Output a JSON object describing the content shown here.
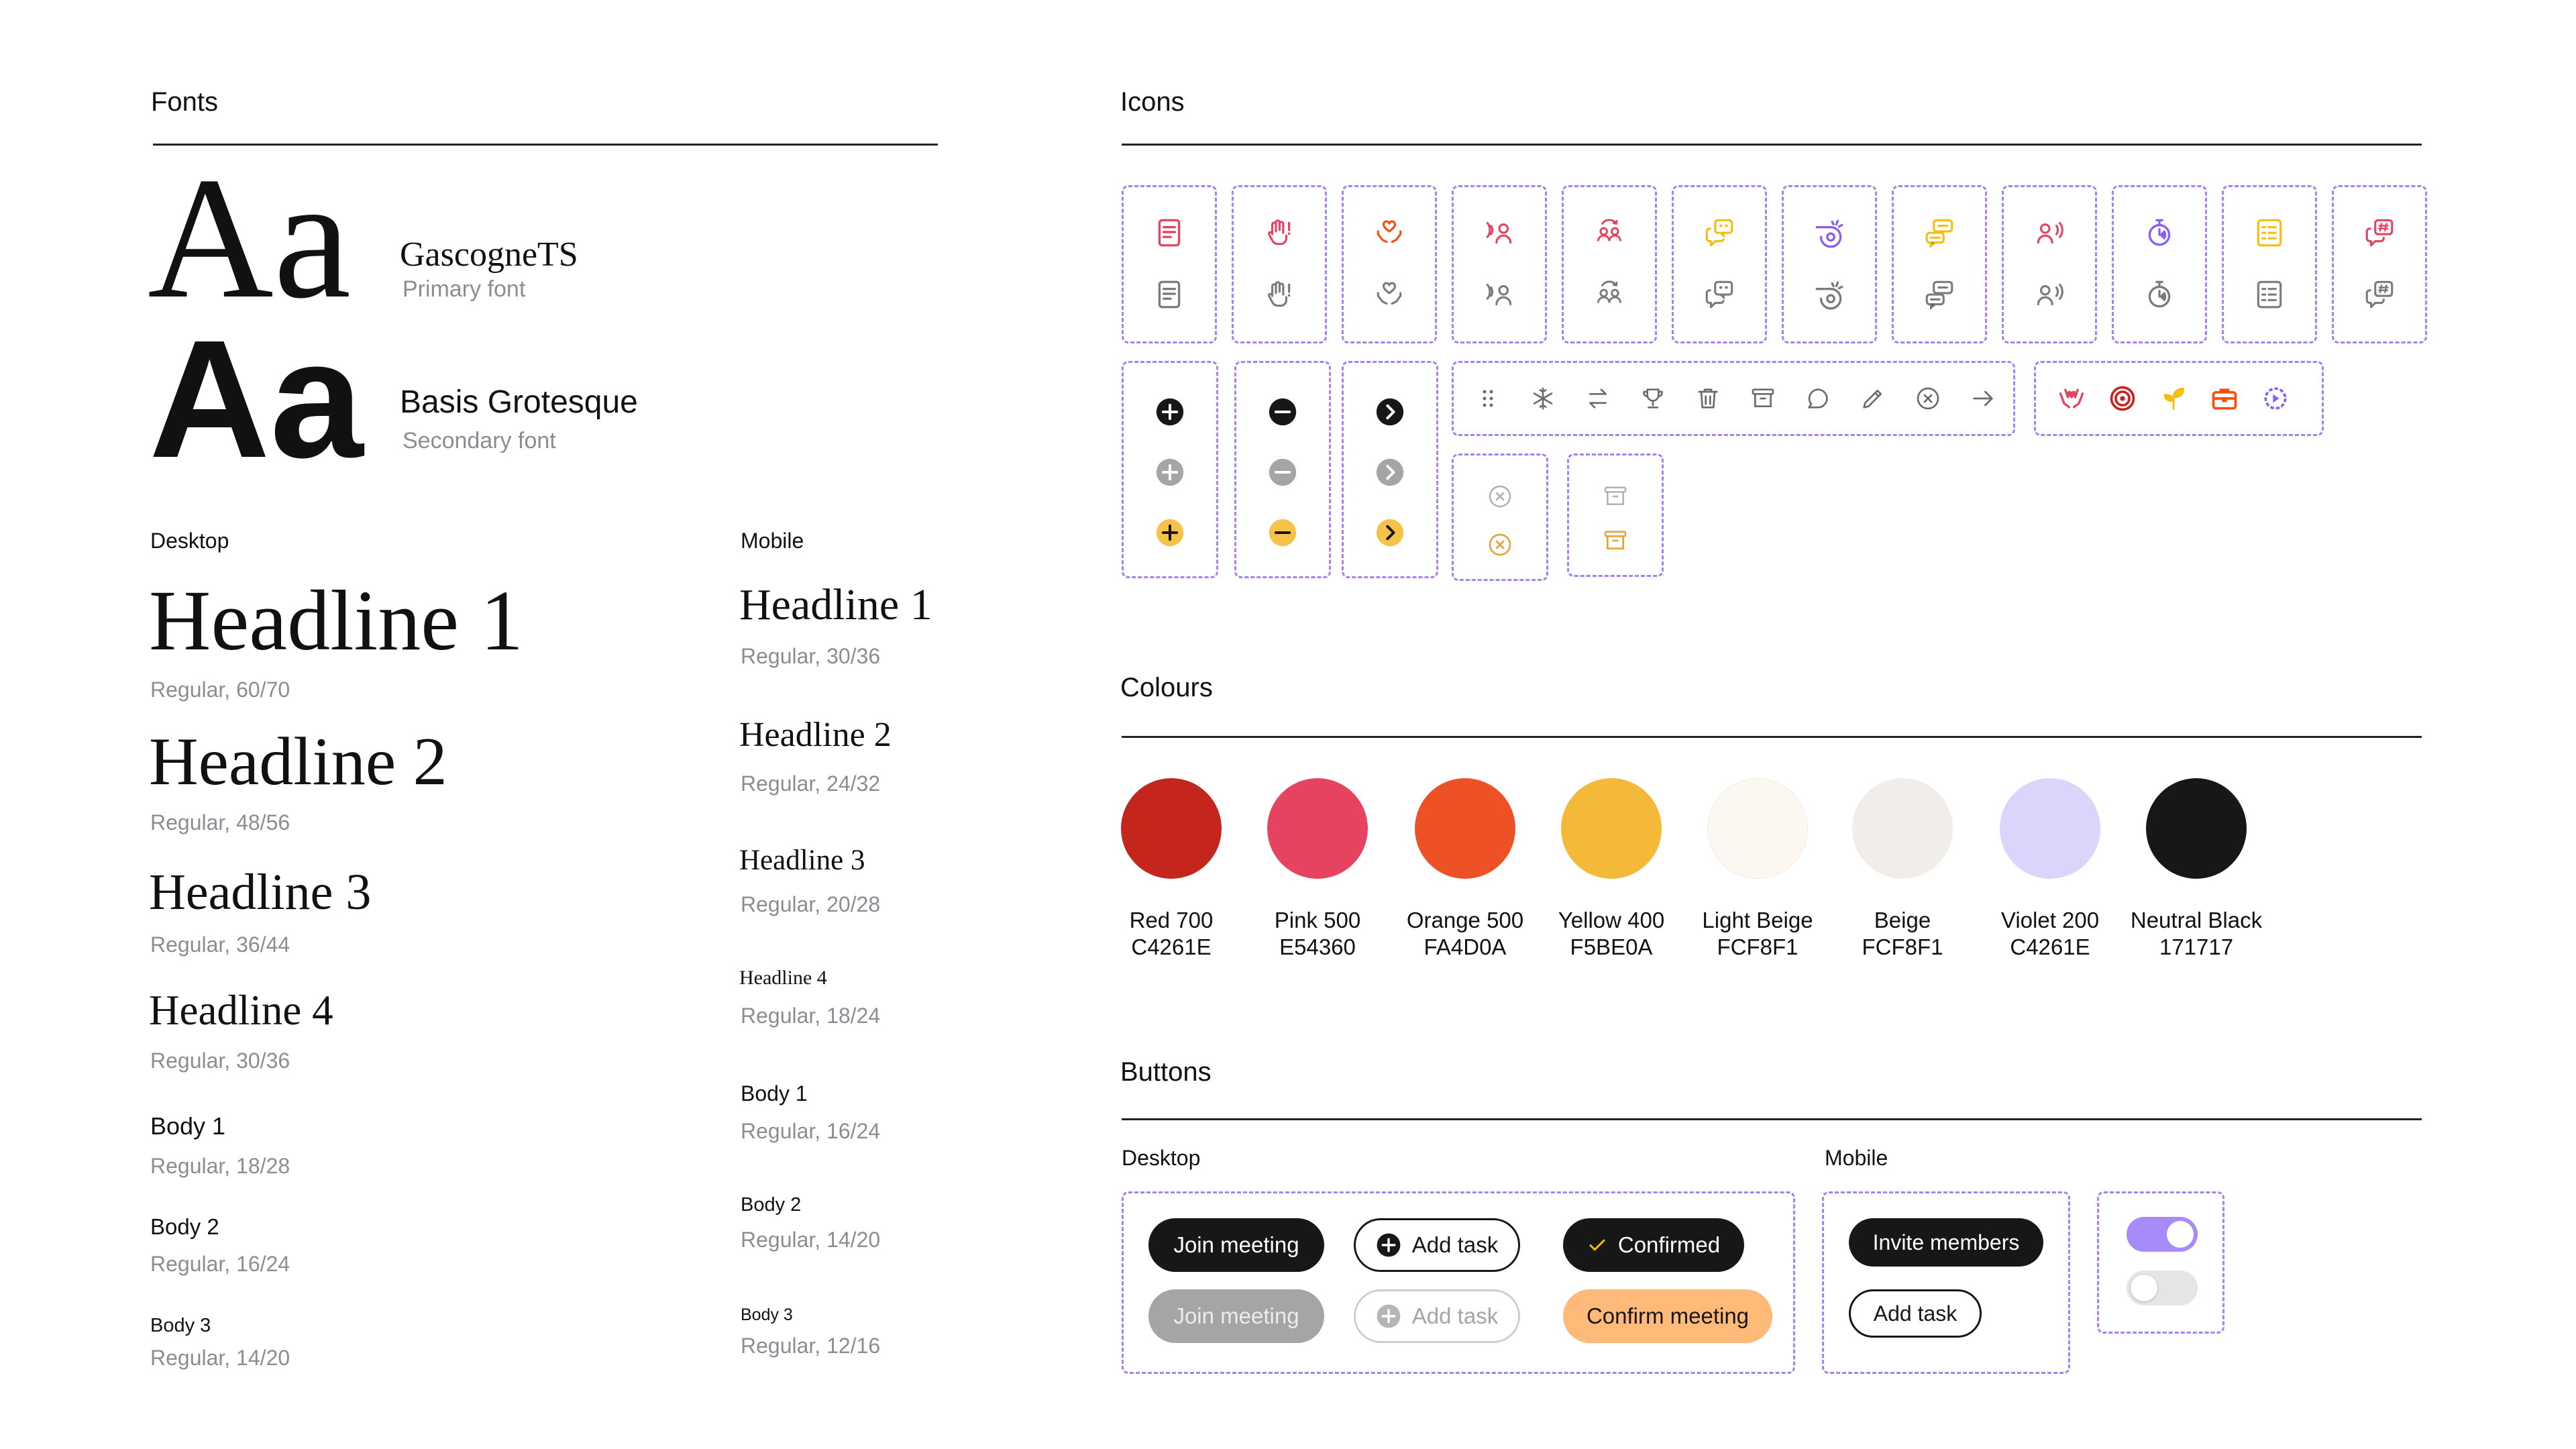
{
  "fonts": {
    "title": "Fonts",
    "primary": {
      "sample": "Aa",
      "name": "GascogneTS",
      "role": "Primary font"
    },
    "secondary": {
      "sample": "Aa",
      "name": "Basis Grotesque",
      "role": "Secondary font"
    }
  },
  "typography": {
    "desktop": {
      "title": "Desktop",
      "items": [
        {
          "name": "Headline 1",
          "spec": "Regular, 60/70"
        },
        {
          "name": "Headline 2",
          "spec": "Regular, 48/56"
        },
        {
          "name": "Headline 3",
          "spec": "Regular, 36/44"
        },
        {
          "name": "Headline 4",
          "spec": "Regular, 30/36"
        },
        {
          "name": "Body 1",
          "spec": "Regular, 18/28"
        },
        {
          "name": "Body 2",
          "spec": "Regular, 16/24"
        },
        {
          "name": "Body 3",
          "spec": "Regular, 14/20"
        }
      ]
    },
    "mobile": {
      "title": "Mobile",
      "items": [
        {
          "name": "Headline 1",
          "spec": "Regular, 30/36"
        },
        {
          "name": "Headline 2",
          "spec": "Regular, 24/32"
        },
        {
          "name": "Headline 3",
          "spec": "Regular, 20/28"
        },
        {
          "name": "Headline 4",
          "spec": "Regular, 18/24"
        },
        {
          "name": "Body 1",
          "spec": "Regular, 16/24"
        },
        {
          "name": "Body 2",
          "spec": "Regular, 14/20"
        },
        {
          "name": "Body 3",
          "spec": "Regular, 12/16"
        }
      ]
    }
  },
  "icons": {
    "title": "Icons",
    "pairs": [
      {
        "name": "document-icon",
        "color": "#e54360"
      },
      {
        "name": "raised-hand-icon",
        "color": "#e54360"
      },
      {
        "name": "caring-hands-icon",
        "color": "#fa4d0a"
      },
      {
        "name": "speaking-person-icon",
        "color": "#e54360"
      },
      {
        "name": "group-sync-icon",
        "color": "#e54360"
      },
      {
        "name": "chat-bubbles-icon",
        "color": "#f5be0a"
      },
      {
        "name": "whistle-icon",
        "color": "#8b5cf6"
      },
      {
        "name": "message-boxes-icon",
        "color": "#f5be0a"
      },
      {
        "name": "person-voice-icon",
        "color": "#e54360"
      },
      {
        "name": "timer-icon",
        "color": "#8b5cf6"
      },
      {
        "name": "checklist-icon",
        "color": "#f5be0a"
      },
      {
        "name": "hashtag-chat-icon",
        "color": "#e54360"
      }
    ],
    "circle_sets": [
      {
        "name": "plus-circle-icon",
        "glyph": "+"
      },
      {
        "name": "minus-circle-icon",
        "glyph": "−"
      },
      {
        "name": "chevron-right-circle-icon",
        "glyph": "›"
      }
    ],
    "utility": [
      "drag-handle-icon",
      "snowflake-icon",
      "swap-arrows-icon",
      "trophy-icon",
      "trash-icon",
      "archive-icon",
      "comment-icon",
      "pencil-icon",
      "close-circle-icon",
      "arrow-right-icon"
    ],
    "colored": [
      {
        "name": "hands-heart-icon",
        "color": "#e54360"
      },
      {
        "name": "target-icon",
        "color": "#c4261e"
      },
      {
        "name": "sprout-icon",
        "color": "#f5be0a"
      },
      {
        "name": "briefcase-icon",
        "color": "#fa4d0a"
      },
      {
        "name": "gear-play-icon",
        "color": "#8b5cf6"
      }
    ],
    "states": [
      "close-circle-icon",
      "archive-icon"
    ]
  },
  "colours": {
    "title": "Colours",
    "items": [
      {
        "name": "Red 700",
        "hex": "C4261E",
        "swatch": "#c4261e"
      },
      {
        "name": "Pink 500",
        "hex": "E54360",
        "swatch": "#e54360"
      },
      {
        "name": "Orange 500",
        "hex": "FA4D0A",
        "swatch": "#ed5125"
      },
      {
        "name": "Yellow 400",
        "hex": "F5BE0A",
        "swatch": "#f5b93a"
      },
      {
        "name": "Light Beige",
        "hex": "FCF8F1",
        "swatch": "#fcf8f1"
      },
      {
        "name": "Beige",
        "hex": "FCF8F1",
        "swatch": "#f1ede8"
      },
      {
        "name": "Violet 200",
        "hex": "C4261E",
        "swatch": "#dcd5fb"
      },
      {
        "name": "Neutral Black",
        "hex": "171717",
        "swatch": "#171717"
      }
    ]
  },
  "buttons": {
    "title": "Buttons",
    "desktop_title": "Desktop",
    "mobile_title": "Mobile",
    "desktop": {
      "join": "Join meeting",
      "add": "Add task",
      "confirmed": "Confirmed",
      "join_disabled": "Join meeting",
      "add_disabled": "Add task",
      "confirm": "Confirm meeting"
    },
    "mobile": {
      "invite": "Invite members",
      "add": "Add task"
    },
    "toggle_on_color": "#a78bfa",
    "toggle_off_color": "#e5e5e5"
  }
}
